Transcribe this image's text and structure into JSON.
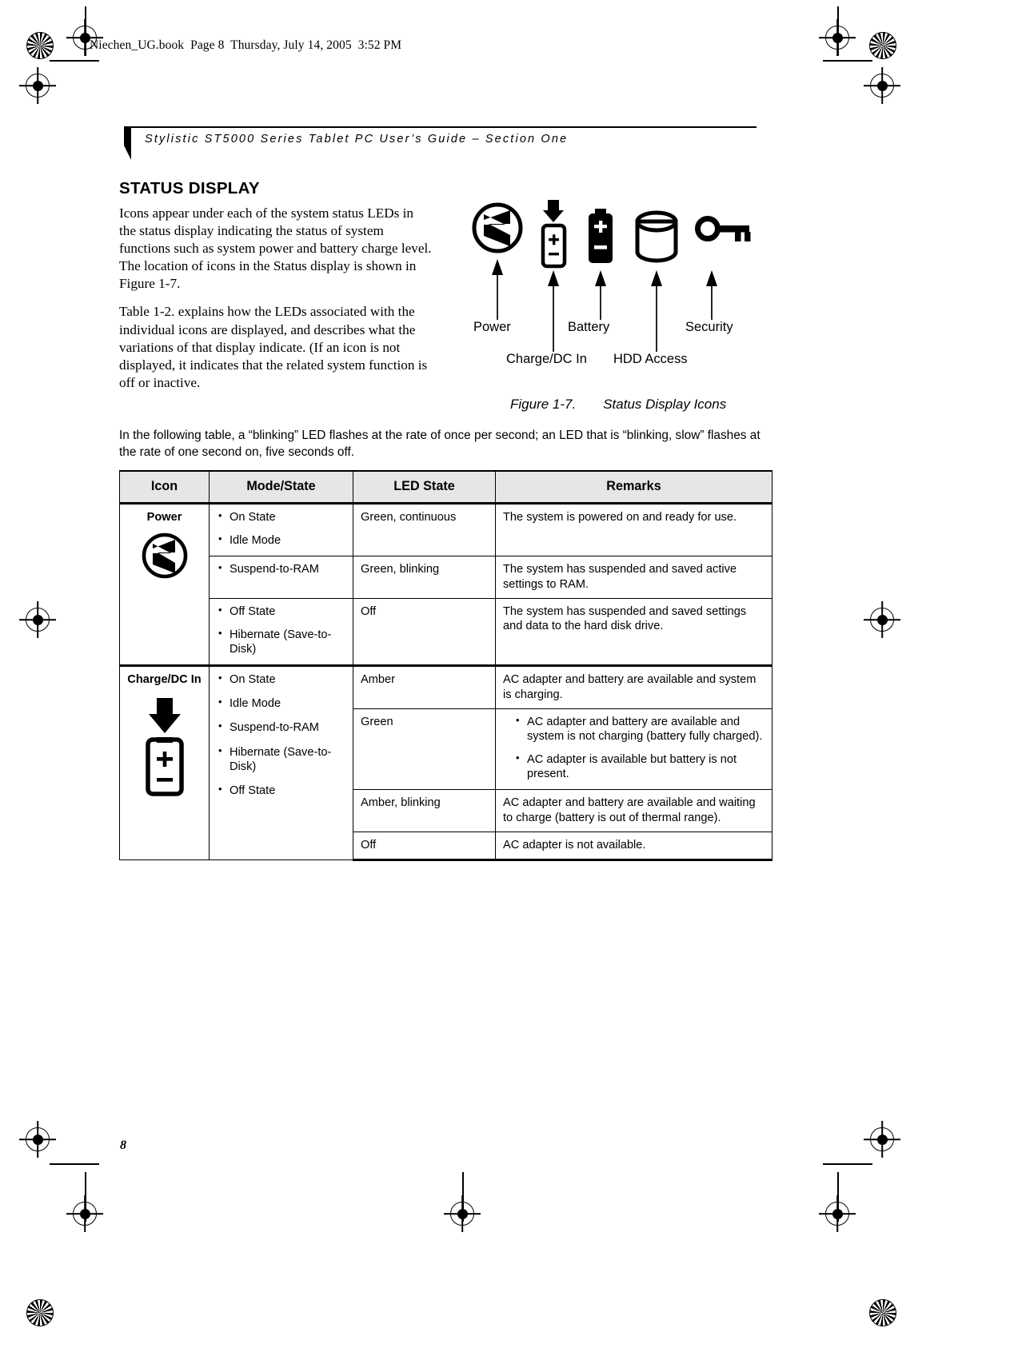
{
  "book_header": "Niechen_UG.book  Page 8  Thursday, July 14, 2005  3:52 PM",
  "running_head": "Stylistic ST5000 Series Tablet PC User’s Guide – Section One",
  "section_title": "STATUS DISPLAY",
  "body_paragraphs": [
    "Icons appear under each of the system status LEDs in the status display indicating the status of system functions such as system power and battery charge level. The location of icons in the Status display is shown in Figure 1-7.",
    "Table 1-2. explains how the LEDs associated with the individual icons are displayed, and describes what the variations of that display indicate. (If an icon is not displayed, it indicates that the related system function is off or inactive."
  ],
  "figure": {
    "labels": {
      "power": "Power",
      "charge_dc_in": "Charge/DC In",
      "battery": "Battery",
      "hdd_access": "HDD Access",
      "security": "Security"
    },
    "icon_names": [
      "power-icon",
      "charge-dc-in-icon",
      "battery-icon",
      "hdd-access-icon",
      "security-key-icon"
    ],
    "caption_number": "Figure 1-7.",
    "caption_title": "Status Display Icons"
  },
  "table_intro": "In the following table, a “blinking” LED flashes at the rate of once per second; an LED that is “blinking, slow” flashes at the rate of one second on, five seconds off.",
  "table": {
    "headers": [
      "Icon",
      "Mode/State",
      "LED State",
      "Remarks"
    ],
    "groups": [
      {
        "icon_label": "Power",
        "icon_name": "power-icon",
        "rows": [
          {
            "modes": [
              "On State",
              "Idle Mode"
            ],
            "led_state": "Green, continuous",
            "remarks": "The system is powered on and ready for use."
          },
          {
            "modes": [
              "Suspend-to-RAM"
            ],
            "led_state": "Green, blinking",
            "remarks": "The system has suspended and saved active settings to RAM."
          },
          {
            "modes": [
              "Off State",
              "Hibernate (Save-to-Disk)"
            ],
            "led_state": "Off",
            "remarks": "The system has suspended and saved settings and data to the hard disk drive."
          }
        ]
      },
      {
        "icon_label": "Charge/DC In",
        "icon_name": "charge-dc-in-icon",
        "modes": [
          "On State",
          "Idle Mode",
          "Suspend-to-RAM",
          "Hibernate (Save-to-Disk)",
          "Off State"
        ],
        "rows": [
          {
            "led_state": "Amber",
            "remarks": "AC adapter and battery are available and system is charging."
          },
          {
            "led_state": "Green",
            "remark_bullets": [
              "AC adapter and battery are available and system is not charging (battery fully charged).",
              "AC adapter is available but battery is not present."
            ]
          },
          {
            "led_state": "Amber, blinking",
            "remarks": "AC adapter and battery are available and waiting to charge (battery is out of thermal range)."
          },
          {
            "led_state": "Off",
            "remarks": "AC adapter is not available."
          }
        ]
      }
    ]
  },
  "page_number": "8"
}
